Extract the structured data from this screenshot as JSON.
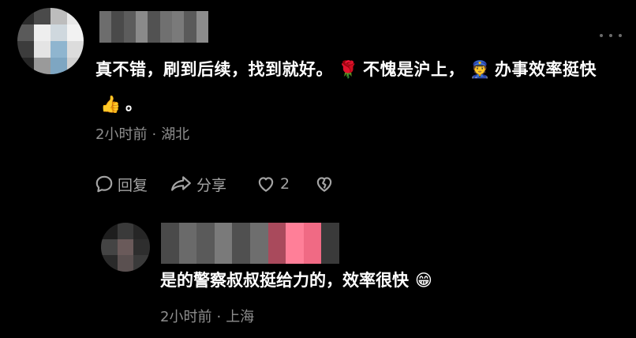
{
  "colors": {
    "background": "#000000",
    "text_primary": "#ffffff",
    "text_secondary": "#8e8e8e",
    "action_gray": "#a4a4a4",
    "more_dots": "#6b6b6b"
  },
  "main_comment": {
    "avatar": "blurred-avatar",
    "author": "blurred-username",
    "text_parts": {
      "p1": "真不错，刷到后续，找到就好。",
      "emoji_rose": "🌹",
      "p2": "不愧是沪上，",
      "emoji_police": "👮",
      "p3": "办事效率挺快",
      "emoji_thumbs": "👍",
      "p4": "。"
    },
    "time": "2小时前",
    "separator": "·",
    "location": "湖北",
    "more_icon": "more-dots-icon"
  },
  "actions": {
    "reply_icon": "comment-bubble-icon",
    "reply_label": "回复",
    "share_icon": "share-arrow-icon",
    "share_label": "分享",
    "like_icon": "heart-outline-icon",
    "like_count": "2",
    "dislike_icon": "broken-heart-icon"
  },
  "reply": {
    "avatar": "blurred-avatar",
    "author": "blurred-username",
    "text": "是的警察叔叔挺给力的，效率很快",
    "emoji_grin": "😁",
    "time": "2小时前",
    "separator": "·",
    "location": "上海"
  }
}
